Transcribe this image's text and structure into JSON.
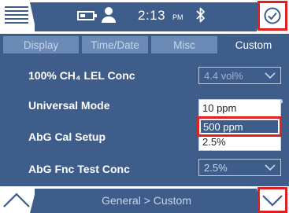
{
  "status_bar": {
    "time": "2:13",
    "ampm": "PM",
    "battery_level": 0.4
  },
  "tabs": [
    {
      "label": "Display",
      "active": false
    },
    {
      "label": "Time/Date",
      "active": false
    },
    {
      "label": "Misc",
      "active": false
    },
    {
      "label": "Custom",
      "active": true
    }
  ],
  "settings": {
    "lel_conc": {
      "label": "100% CH₄ LEL Conc",
      "value": "4.4 vol%"
    },
    "universal_mode": {
      "label": "Universal Mode"
    },
    "abg_cal_setup": {
      "label": "AbG Cal Setup"
    },
    "abg_fnc_test_conc": {
      "label": "AbG Fnc Test Conc",
      "value": "2.5%"
    }
  },
  "dropdown": {
    "options": [
      "10 ppm",
      "500 ppm",
      "2.5%"
    ],
    "selected": "500 ppm"
  },
  "footer": {
    "breadcrumb": "General > Custom"
  },
  "icons": {
    "menu": "hamburger-menu-icon",
    "battery": "battery-icon",
    "user": "user-icon",
    "bluetooth": "bluetooth-icon",
    "confirm": "check-circle-icon",
    "up": "chevron-up-icon",
    "down": "chevron-down-icon"
  },
  "colors": {
    "primary": "#3e5d8a",
    "tab_inactive": "#6b8ab6",
    "highlight_border": "#e02020"
  }
}
